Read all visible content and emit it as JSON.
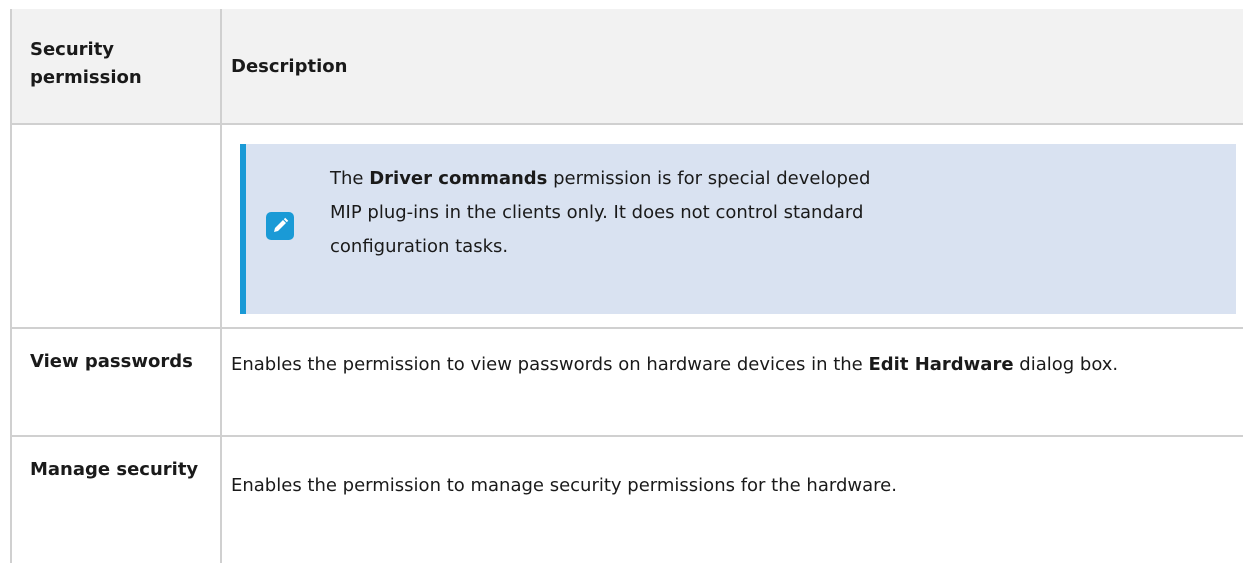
{
  "header": {
    "permission_col": "Security permission",
    "description_col": "Description"
  },
  "note": {
    "icon": "pencil-icon",
    "text_pre": "The ",
    "text_bold": "Driver commands",
    "text_post": " permission is for special developed MIP plug-ins in the clients only. It does not control standard configuration tasks."
  },
  "rows": [
    {
      "permission": "View passwords",
      "desc_pre": "Enables the permission to view passwords on hardware devices in the ",
      "desc_bold": "Edit Hardware",
      "desc_post": " dialog box."
    },
    {
      "permission": "Manage security",
      "desc_pre": "Enables the permission to manage security permissions for the hardware.",
      "desc_bold": "",
      "desc_post": ""
    }
  ],
  "colors": {
    "note_bg": "#d9e2f1",
    "note_accent": "#1a9ad6",
    "header_bg": "#f2f2f2",
    "border": "#d0d0d0"
  }
}
